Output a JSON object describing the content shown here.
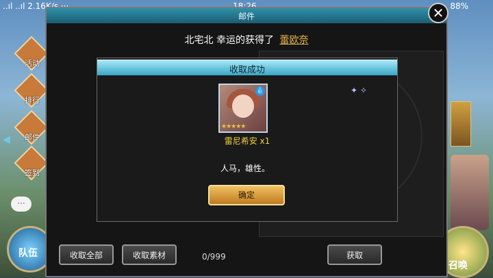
{
  "status": {
    "signal": "..ıl ..ıl 2.16K/s ···",
    "time": "18:26",
    "battery": "88%"
  },
  "side_menu": [
    {
      "label": "活动"
    },
    {
      "label": "排行"
    },
    {
      "label": "邮件"
    },
    {
      "label": "签到"
    }
  ],
  "left_orb_label": "队伍",
  "right_orb_label": "召唤",
  "mail": {
    "title": "邮件",
    "notice_user": "北宅北 幸运的获得了",
    "notice_prize": "蕾欧奈",
    "buttons": {
      "receive_all": "收取全部",
      "receive_materials": "收取素材",
      "get": "获取"
    },
    "counter": "0/999"
  },
  "dialog": {
    "title": "收取成功",
    "item_name": "雷尼希安 x1",
    "item_desc": "人马，雄性。",
    "confirm": "确定",
    "stars": "★★★★★"
  },
  "icons": {
    "close": "close-icon",
    "chat": "chat-bubble-icon",
    "arrow": "arrow-left-icon"
  }
}
